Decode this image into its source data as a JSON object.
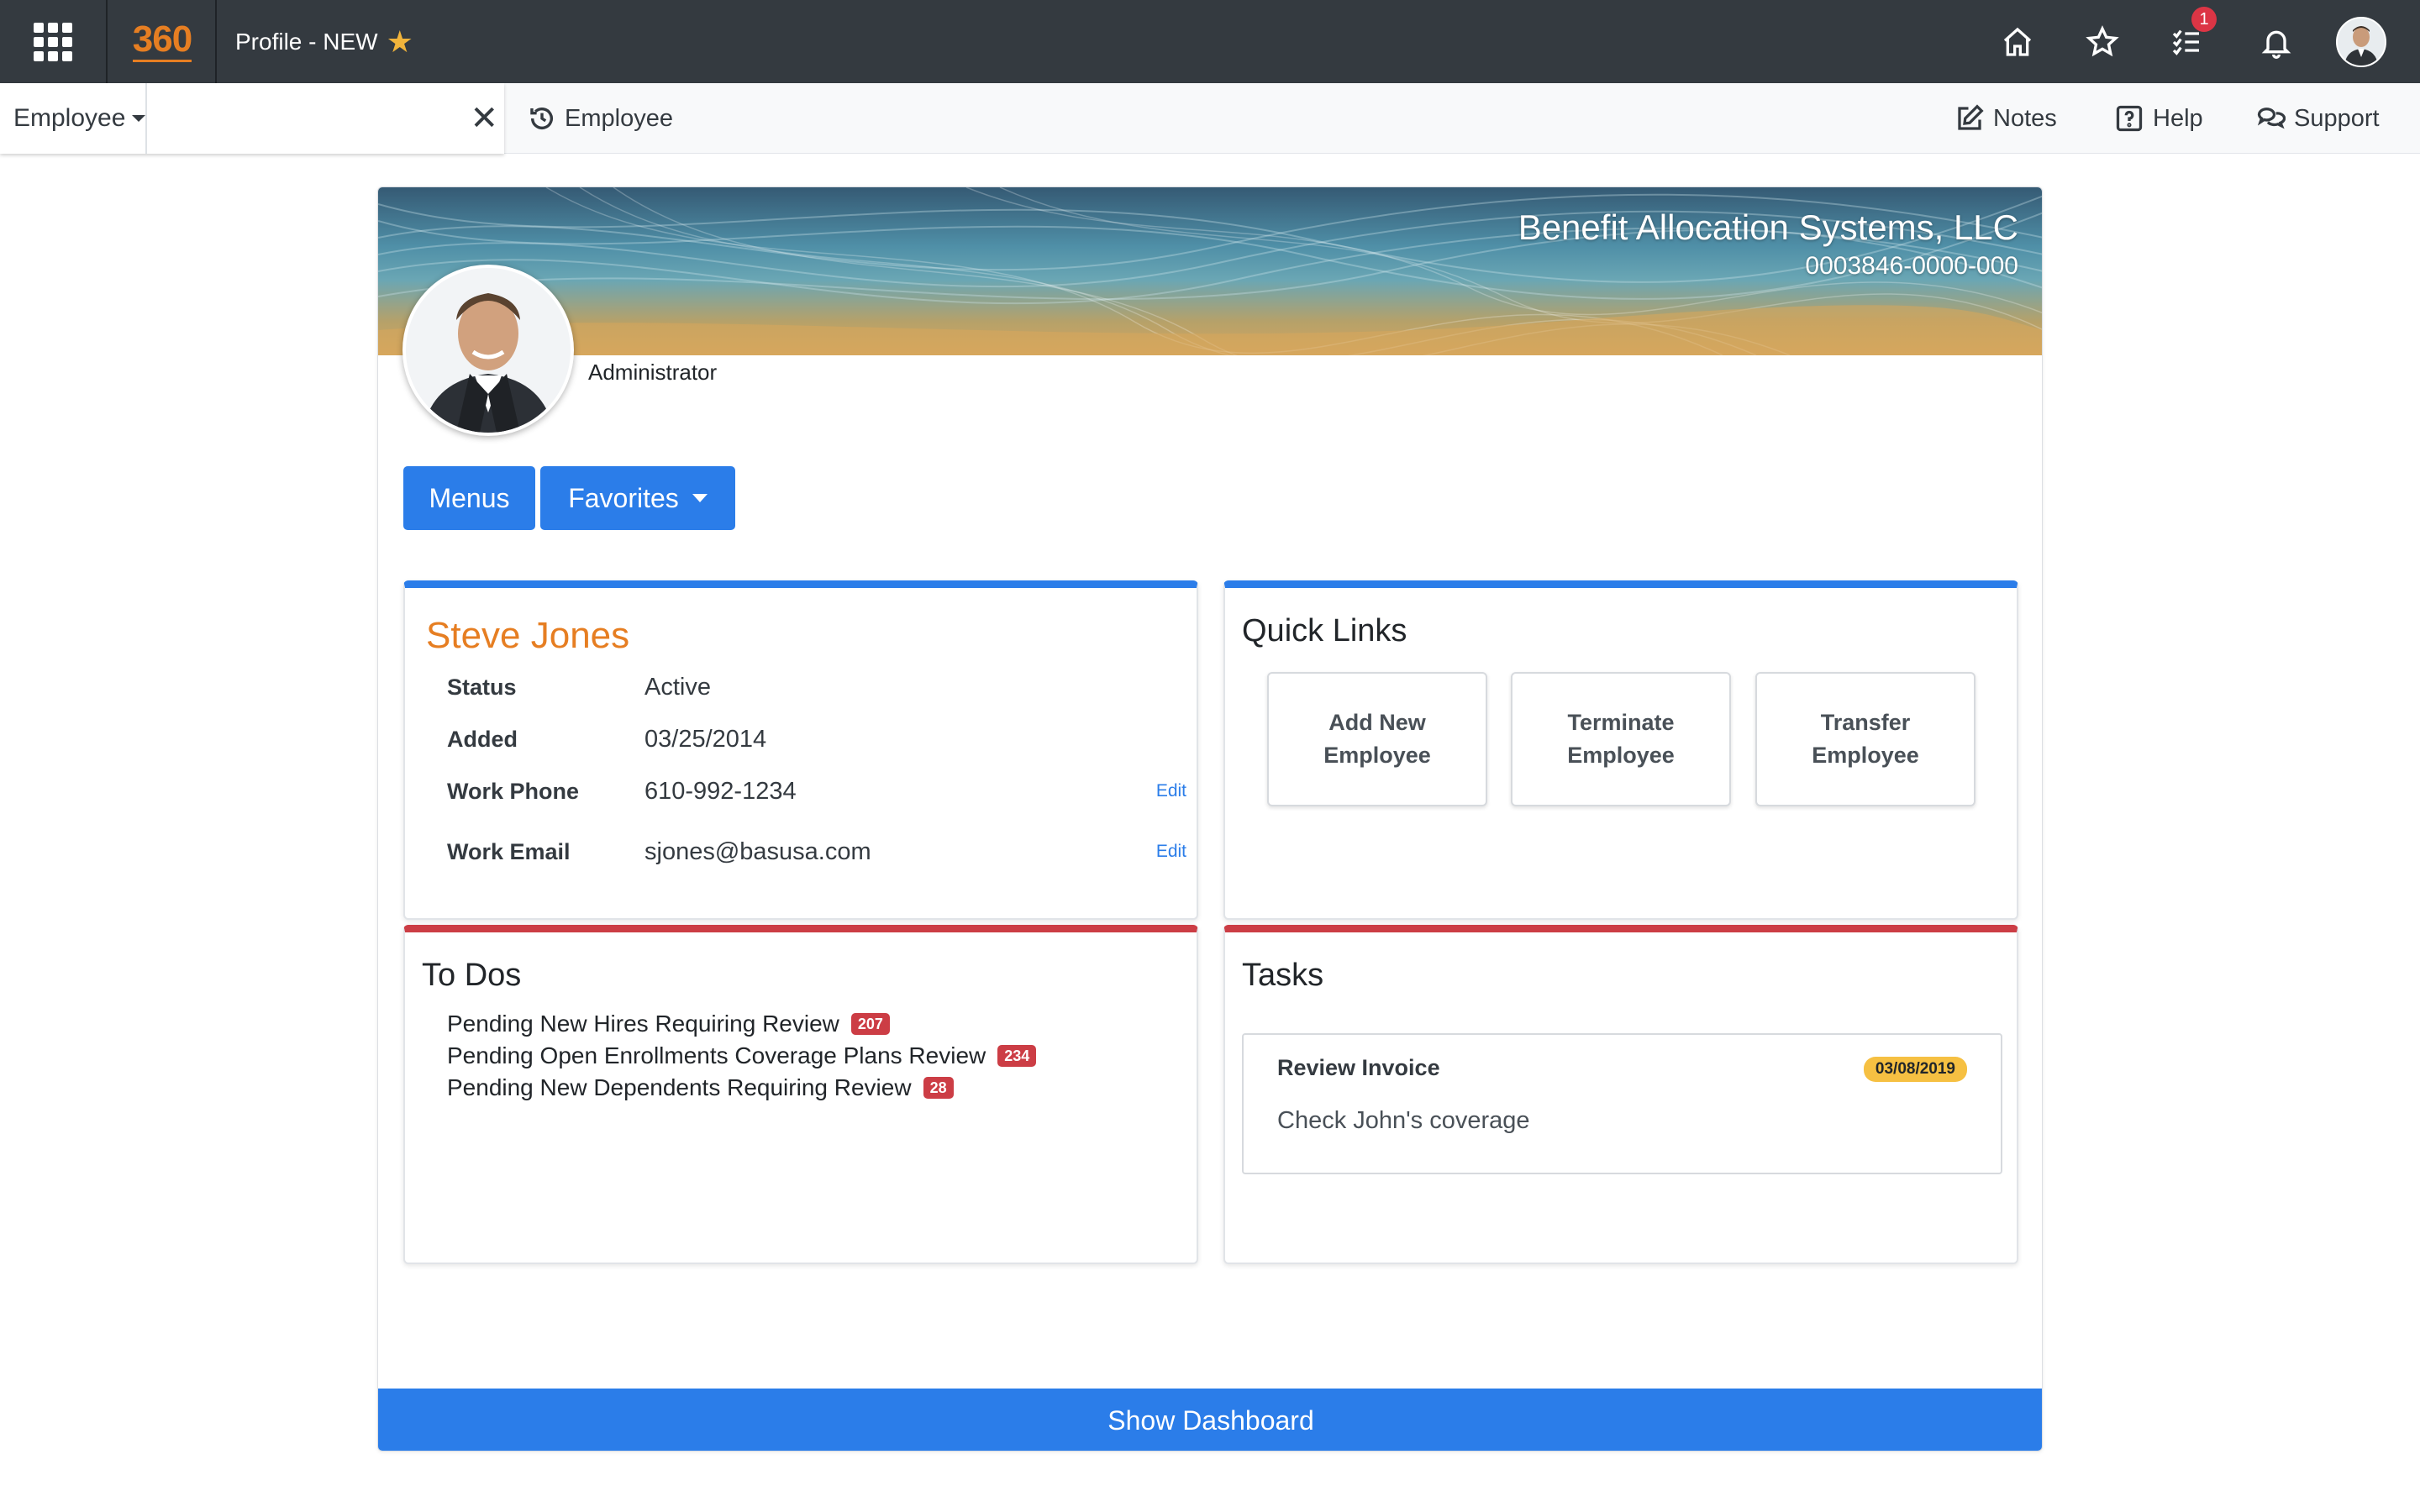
{
  "topbar": {
    "logo": "360",
    "page_title": "Profile - NEW",
    "notification_count": "1"
  },
  "subbar": {
    "scope": "Employee",
    "search_value": "",
    "recent_label": "Employee",
    "notes_label": "Notes",
    "help_label": "Help",
    "support_label": "Support"
  },
  "banner": {
    "company_name": "Benefit Allocation Systems, LLC",
    "company_id": "0003846-0000-000"
  },
  "profile": {
    "role": "Administrator"
  },
  "actions": {
    "menus_label": "Menus",
    "favorites_label": "Favorites"
  },
  "employee": {
    "name": "Steve Jones",
    "rows": [
      {
        "label": "Status",
        "value": "Active",
        "edit": ""
      },
      {
        "label": "Added",
        "value": "03/25/2014",
        "edit": ""
      },
      {
        "label": "Work Phone",
        "value": "610-992-1234",
        "edit": "Edit"
      },
      {
        "label": "Work Email",
        "value": "sjones@basusa.com",
        "edit": "Edit"
      }
    ]
  },
  "quick_links": {
    "title": "Quick Links",
    "items": [
      "Add New Employee",
      "Terminate Employee",
      "Transfer Employee"
    ]
  },
  "todos": {
    "title": "To Dos",
    "items": [
      {
        "label": "Pending New Hires Requiring Review",
        "count": "207"
      },
      {
        "label": "Pending Open Enrollments Coverage Plans Review",
        "count": "234"
      },
      {
        "label": "Pending New Dependents Requiring Review",
        "count": "28"
      }
    ]
  },
  "tasks": {
    "title": "Tasks",
    "items": [
      {
        "title": "Review Invoice",
        "date": "03/08/2019",
        "description": "Check John's coverage"
      }
    ]
  },
  "footer": {
    "show_dashboard_label": "Show Dashboard"
  },
  "colors": {
    "topbar": "#343a40",
    "accent_blue": "#2b7de9",
    "accent_orange": "#e67e22",
    "accent_red": "#cc3d45",
    "date_badge": "#f6c042"
  },
  "icons": [
    "apps-grid-icon",
    "favorite-star-icon",
    "home-icon",
    "star-icon",
    "tasks-checklist-icon",
    "bell-icon",
    "history-icon",
    "edit-note-icon",
    "help-icon",
    "support-chat-icon",
    "close-icon"
  ]
}
